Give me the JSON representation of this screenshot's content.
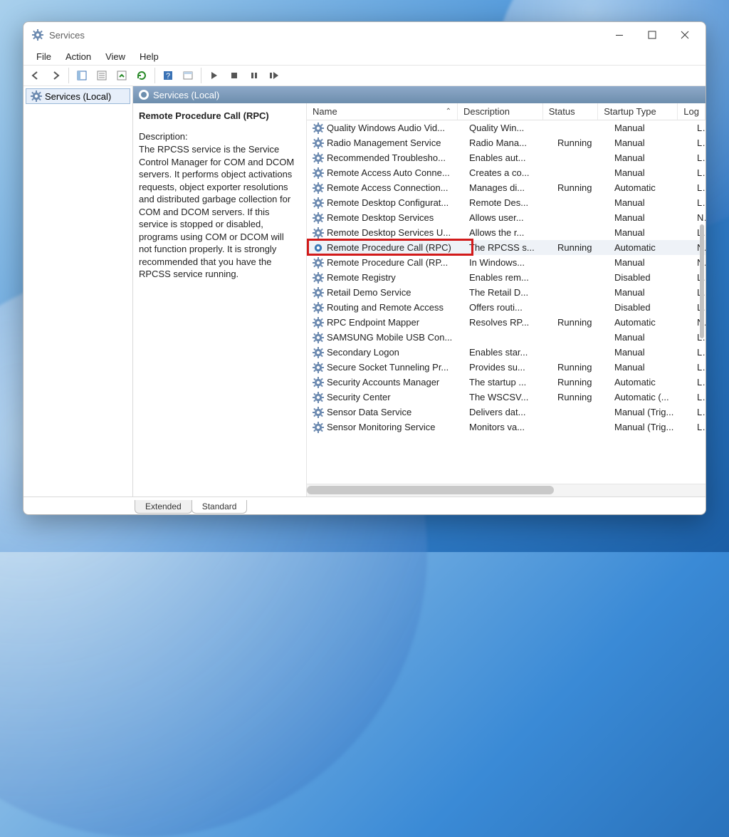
{
  "window": {
    "title": "Services"
  },
  "menu": {
    "file": "File",
    "action": "Action",
    "view": "View",
    "help": "Help"
  },
  "tree": {
    "root": "Services (Local)"
  },
  "paneTitle": "Services (Local)",
  "detail": {
    "selectedName": "Remote Procedure Call (RPC)",
    "descLabel": "Description:",
    "descText": "The RPCSS service is the Service Control Manager for COM and DCOM servers. It performs object activations requests, object exporter resolutions and distributed garbage collection for COM and DCOM servers. If this service is stopped or disabled, programs using COM or DCOM will not function properly. It is strongly recommended that you have the RPCSS service running."
  },
  "columns": {
    "name": "Name",
    "description": "Description",
    "status": "Status",
    "startup": "Startup Type",
    "logon": "Log"
  },
  "services": [
    {
      "name": "Quality Windows Audio Vid...",
      "desc": "Quality Win...",
      "status": "",
      "start": "Manual",
      "log": "Loca"
    },
    {
      "name": "Radio Management Service",
      "desc": "Radio Mana...",
      "status": "Running",
      "start": "Manual",
      "log": "Loca"
    },
    {
      "name": "Recommended Troublesho...",
      "desc": "Enables aut...",
      "status": "",
      "start": "Manual",
      "log": "Loca"
    },
    {
      "name": "Remote Access Auto Conne...",
      "desc": "Creates a co...",
      "status": "",
      "start": "Manual",
      "log": "Loca"
    },
    {
      "name": "Remote Access Connection...",
      "desc": "Manages di...",
      "status": "Running",
      "start": "Automatic",
      "log": "Loca"
    },
    {
      "name": "Remote Desktop Configurat...",
      "desc": "Remote Des...",
      "status": "",
      "start": "Manual",
      "log": "Loca"
    },
    {
      "name": "Remote Desktop Services",
      "desc": "Allows user...",
      "status": "",
      "start": "Manual",
      "log": "Netv"
    },
    {
      "name": "Remote Desktop Services U...",
      "desc": "Allows the r...",
      "status": "",
      "start": "Manual",
      "log": "Loca"
    },
    {
      "name": "Remote Procedure Call (RPC)",
      "desc": "The RPCSS s...",
      "status": "Running",
      "start": "Automatic",
      "log": "Netv",
      "selected": true,
      "highlight": true
    },
    {
      "name": "Remote Procedure Call (RP...",
      "desc": "In Windows...",
      "status": "",
      "start": "Manual",
      "log": "Netv"
    },
    {
      "name": "Remote Registry",
      "desc": "Enables rem...",
      "status": "",
      "start": "Disabled",
      "log": "Loca"
    },
    {
      "name": "Retail Demo Service",
      "desc": "The Retail D...",
      "status": "",
      "start": "Manual",
      "log": "Loca"
    },
    {
      "name": "Routing and Remote Access",
      "desc": "Offers routi...",
      "status": "",
      "start": "Disabled",
      "log": "Loca"
    },
    {
      "name": "RPC Endpoint Mapper",
      "desc": "Resolves RP...",
      "status": "Running",
      "start": "Automatic",
      "log": "Netv"
    },
    {
      "name": "SAMSUNG Mobile USB Con...",
      "desc": "",
      "status": "",
      "start": "Manual",
      "log": "Loca"
    },
    {
      "name": "Secondary Logon",
      "desc": "Enables star...",
      "status": "",
      "start": "Manual",
      "log": "Loca"
    },
    {
      "name": "Secure Socket Tunneling Pr...",
      "desc": "Provides su...",
      "status": "Running",
      "start": "Manual",
      "log": "Loca"
    },
    {
      "name": "Security Accounts Manager",
      "desc": "The startup ...",
      "status": "Running",
      "start": "Automatic",
      "log": "Loca"
    },
    {
      "name": "Security Center",
      "desc": "The WSCSV...",
      "status": "Running",
      "start": "Automatic (...",
      "log": "Loca"
    },
    {
      "name": "Sensor Data Service",
      "desc": "Delivers dat...",
      "status": "",
      "start": "Manual (Trig...",
      "log": "Loca"
    },
    {
      "name": "Sensor Monitoring Service",
      "desc": "Monitors va...",
      "status": "",
      "start": "Manual (Trig...",
      "log": "Loca"
    }
  ],
  "tabs": {
    "extended": "Extended",
    "standard": "Standard"
  }
}
